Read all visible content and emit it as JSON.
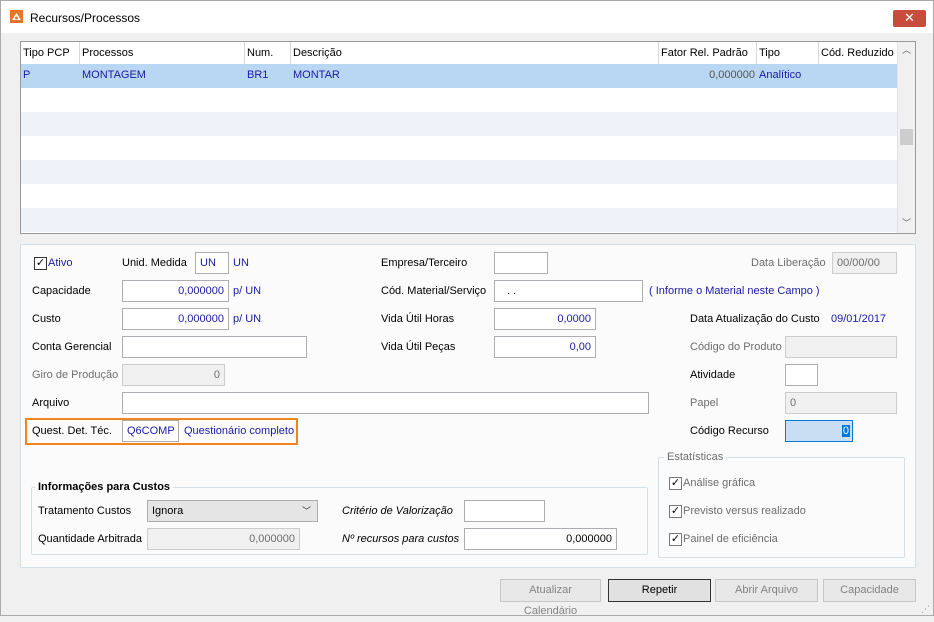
{
  "window": {
    "title": "Recursos/Processos",
    "close_label": "✕"
  },
  "grid": {
    "headers": [
      "Tipo PCP",
      "Processos",
      "Num.",
      "Descrição",
      "Fator Rel. Padrão",
      "Tipo",
      "Cód. Reduzido"
    ],
    "rows": [
      {
        "tipo_pcp": "P",
        "processos": "MONTAGEM",
        "num": "BR1",
        "descricao": "MONTAR",
        "fator": "0,000000",
        "tipo": "Analítico",
        "cod_reduzido": ""
      }
    ]
  },
  "form": {
    "ativo_label": "Ativo",
    "ativo_checked": true,
    "unid_medida_label": "Unid. Medida",
    "unid_medida_value": "UN",
    "unid_medida_desc": "UN",
    "capacidade_label": "Capacidade",
    "capacidade_value": "0,000000",
    "capacidade_unit": "p/ UN",
    "custo_label": "Custo",
    "custo_value": "0,000000",
    "custo_unit": "p/ UN",
    "conta_gerencial_label": "Conta Gerencial",
    "conta_gerencial_value": "",
    "giro_producao_label": "Giro de Produção",
    "giro_producao_value": "0",
    "arquivo_label": "Arquivo",
    "arquivo_value": "",
    "quest_label": "Quest. Det. Téc.",
    "quest_code": "Q6COMP",
    "quest_desc": "Questionário completo",
    "empresa_terceiro_label": "Empresa/Terceiro",
    "empresa_terceiro_value": "",
    "cod_material_label": "Cód. Material/Serviço",
    "cod_material_value": ".   .",
    "cod_material_hint": "( Informe o Material neste Campo )",
    "vida_util_horas_label": "Vida Útil Horas",
    "vida_util_horas_value": "0,0000",
    "vida_util_pecas_label": "Vida Útil Peças",
    "vida_util_pecas_value": "0,00",
    "data_liberacao_label": "Data Liberação",
    "data_liberacao_value": "00/00/00",
    "data_atualizacao_label": "Data Atualização do Custo",
    "data_atualizacao_value": "09/01/2017",
    "codigo_produto_label": "Código do Produto",
    "codigo_produto_value": "",
    "atividade_label": "Atividade",
    "atividade_value": "",
    "papel_label": "Papel",
    "papel_value": "0",
    "codigo_recurso_label": "Código Recurso",
    "codigo_recurso_value": "0"
  },
  "custos": {
    "title": "Informações para Custos",
    "tratamento_label": "Tratamento Custos",
    "tratamento_value": "Ignora",
    "quantidade_label": "Quantidade Arbitrada",
    "quantidade_value": "0,000000",
    "criterio_label": "Critério de Valorização",
    "criterio_value": "",
    "n_recursos_label": "Nº recursos para custos",
    "n_recursos_value": "0,000000"
  },
  "estatisticas": {
    "title": "Estatísticas",
    "items": [
      {
        "label": "Análise gráfica",
        "checked": true
      },
      {
        "label": "Previsto versus realizado",
        "checked": true
      },
      {
        "label": "Painel de eficiência",
        "checked": true
      }
    ]
  },
  "buttons": {
    "atualizar_calendario": "Atualizar Calendário",
    "repetir": "Repetir",
    "abrir_arquivo": "Abrir Arquivo",
    "capacidade": "Capacidade"
  }
}
